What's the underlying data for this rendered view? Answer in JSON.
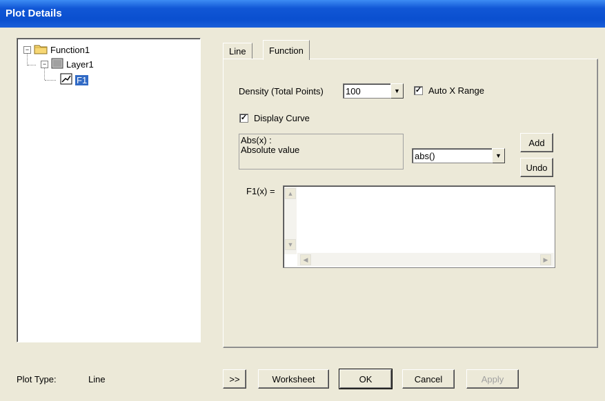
{
  "window": {
    "title": "Plot Details"
  },
  "tree": {
    "nodes": [
      {
        "label": "Function1",
        "icon": "folder-icon"
      },
      {
        "label": "Layer1",
        "icon": "layer-icon"
      },
      {
        "label": "F1",
        "icon": "function-plot-icon",
        "selected": true
      }
    ]
  },
  "tabs": [
    {
      "label": "Line",
      "active": false
    },
    {
      "label": "Function",
      "active": true
    }
  ],
  "function_tab": {
    "density_label": "Density (Total Points)",
    "density_value": "100",
    "auto_x_range_label": "Auto X Range",
    "auto_x_range_checked": true,
    "display_curve_label": "Display Curve",
    "display_curve_checked": true,
    "description_line1": "Abs(x) :",
    "description_line2": "Absolute value",
    "function_select_value": "abs()",
    "add_label": "Add",
    "undo_label": "Undo",
    "formula_label": "F1(x) =",
    "formula_value": ""
  },
  "footer": {
    "plot_type_label": "Plot Type:",
    "plot_type_value": "Line",
    "expand_label": ">>",
    "worksheet_label": "Worksheet",
    "ok_label": "OK",
    "cancel_label": "Cancel",
    "apply_label": "Apply"
  },
  "colors": {
    "titlebar": "#0a4fcf",
    "dialog_bg": "#ece9d8",
    "selection": "#316ac5"
  }
}
